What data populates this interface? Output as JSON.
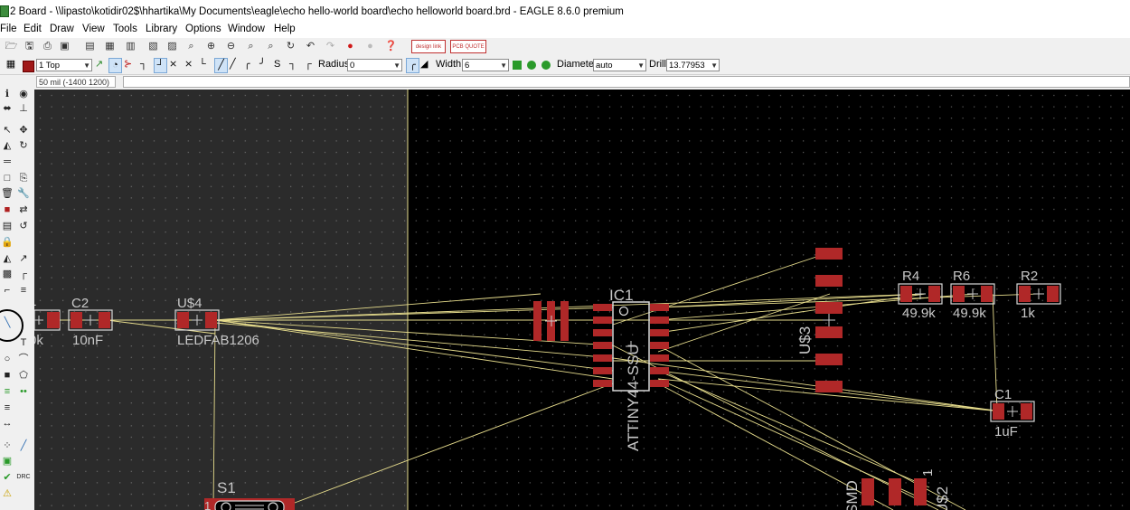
{
  "window": {
    "title": "2 Board - \\\\lipasto\\kotidir02$\\hhartika\\My Documents\\eagle\\echo hello-world board\\echo helloworld board.brd - EAGLE 8.6.0 premium"
  },
  "menu": [
    "File",
    "Edit",
    "Draw",
    "View",
    "Tools",
    "Library",
    "Options",
    "Window",
    "Help"
  ],
  "toolbar": {
    "layer": "1 Top",
    "radius_label": "Radius:",
    "radius_value": "0",
    "width_label": "Width:",
    "width_value": "6",
    "diameter_label": "Diameter:",
    "diameter_value": "auto",
    "drill_label": "Drill:",
    "drill_value": "13.77953",
    "design_link_label": "design link",
    "pcb_quote_label": "PCB QUOTE"
  },
  "command": {
    "coordinates": "50 mil (-1400 1200)",
    "input": ""
  },
  "board": {
    "components": {
      "c2_name": "C2",
      "c2_value": "10nF",
      "us4_name": "U$4",
      "us4_value": "LEDFAB1206",
      "ic1_name": "IC1",
      "ic1_value": "ATTINY44-SSU",
      "us3_name": "U$3",
      "r4_name": "R4",
      "r4_value": "49.9k",
      "r6_name": "R6",
      "r6_value": "49.9k",
      "r2_name": "R2",
      "r2_value": "1k",
      "c1_name": "C1",
      "c1_value": "1uF",
      "s1_name": "S1",
      "us2_name": "U$2",
      "smd_label": "SMD",
      "pin1_label": "1",
      "left_partial_name": "1",
      "left_partial_value": "0k",
      "s1_pad_label": "1"
    }
  },
  "colors": {
    "pad": "#b02828",
    "airwire": "#e6dc8c",
    "background": "#000000",
    "outline": "#d8d8d8"
  }
}
